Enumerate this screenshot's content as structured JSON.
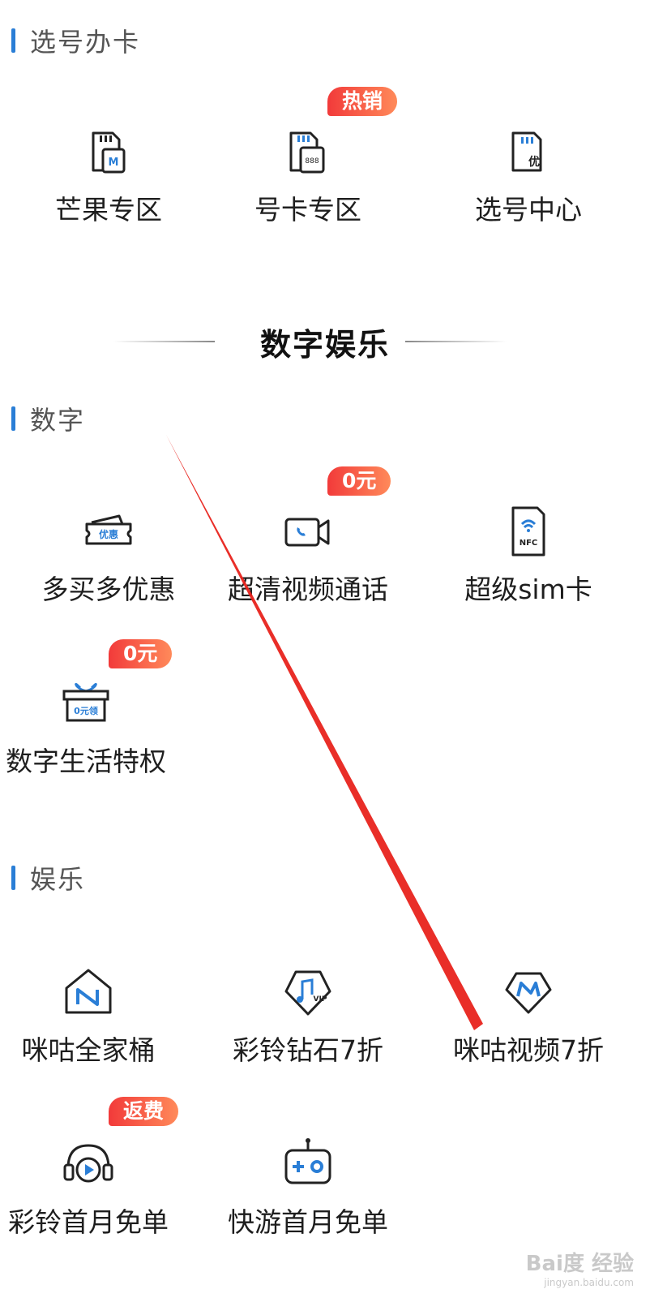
{
  "sections": {
    "card": {
      "title": "选号办卡"
    },
    "entertainment_heading": "数字娱乐",
    "digital": {
      "title": "数字"
    },
    "ent": {
      "title": "娱乐"
    }
  },
  "card_items": [
    {
      "label": "芒果专区",
      "icon": "mango-sim-icon"
    },
    {
      "label": "号卡专区",
      "icon": "number-card-icon",
      "badge": "热销"
    },
    {
      "label": "选号中心",
      "icon": "number-selection-icon"
    }
  ],
  "digital_items": [
    {
      "label": "多买多优惠",
      "icon": "coupon-icon"
    },
    {
      "label": "超清视频通话",
      "icon": "video-call-icon",
      "badge": "0元"
    },
    {
      "label": "超级sim卡",
      "icon": "nfc-sim-icon"
    },
    {
      "label": "数字生活特权",
      "icon": "gift-box-icon",
      "badge": "0元"
    }
  ],
  "ent_items": [
    {
      "label": "咪咕全家桶",
      "icon": "migu-home-icon"
    },
    {
      "label": "彩铃钻石7折",
      "icon": "ringtone-vip-icon"
    },
    {
      "label": "咪咕视频7折",
      "icon": "migu-video-icon"
    },
    {
      "label": "彩铃首月免单",
      "icon": "headphone-play-icon",
      "badge": "返费"
    },
    {
      "label": "快游首月免单",
      "icon": "gamepad-icon"
    }
  ],
  "icon_texts": {
    "mango_sim": "M",
    "number_card": "888",
    "number_selection": "优",
    "coupon": "优惠",
    "nfc": "NFC",
    "gift_box": "0元领",
    "vip": "VIP"
  },
  "watermark": {
    "brand": "Bai度 经验",
    "url": "jingyan.baidu.com"
  },
  "colors": {
    "accent_blue": "#2a7ed6",
    "badge_red": "#f23a3a",
    "badge_orange": "#ff8a5a",
    "annotation_red": "#e8231c"
  }
}
